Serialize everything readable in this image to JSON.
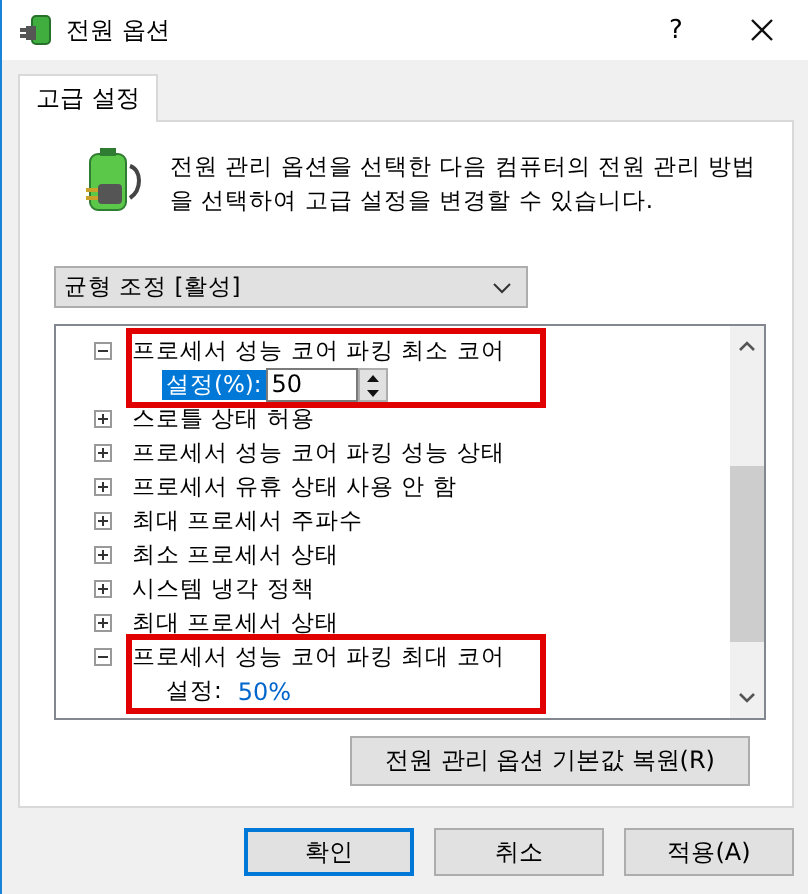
{
  "window": {
    "title": "전원 옵션",
    "help": "?"
  },
  "tabs": [
    {
      "label": "고급 설정",
      "selected": true
    }
  ],
  "description": "전원 관리 옵션을 선택한 다음 컴퓨터의 전원 관리 방법을 선택하여 고급 설정을 변경할 수 있습니다.",
  "plan_dropdown": {
    "value": "균형 조정 [활성]"
  },
  "tree": [
    {
      "label": "프로세서 성능 코어 파킹 최소 코어",
      "expanded": true,
      "highlighted": true,
      "children": [
        {
          "kind": "spin",
          "label": "설정(%):",
          "value": "50",
          "selected": true
        }
      ]
    },
    {
      "label": "스로틀 상태 허용",
      "expanded": false,
      "highlighted": false
    },
    {
      "label": "프로세서 성능 코어 파킹 성능 상태",
      "expanded": false,
      "highlighted": false
    },
    {
      "label": "프로세서 유휴 상태 사용 안 함",
      "expanded": false,
      "highlighted": false
    },
    {
      "label": "최대 프로세서 주파수",
      "expanded": false,
      "highlighted": false
    },
    {
      "label": "최소 프로세서 상태",
      "expanded": false,
      "highlighted": false
    },
    {
      "label": "시스템 냉각 정책",
      "expanded": false,
      "highlighted": false
    },
    {
      "label": "최대 프로세서 상태",
      "expanded": false,
      "highlighted": false
    },
    {
      "label": "프로세서 성능 코어 파킹 최대 코어",
      "expanded": true,
      "highlighted": true,
      "children": [
        {
          "kind": "value",
          "label": "설정:",
          "value": "50%",
          "selected": false
        }
      ]
    }
  ],
  "restore_button": "전원 관리 옵션 기본값 복원(R)",
  "buttons": [
    {
      "label": "확인",
      "default": true
    },
    {
      "label": "취소",
      "default": false
    },
    {
      "label": "적용(A)",
      "default": false
    }
  ]
}
